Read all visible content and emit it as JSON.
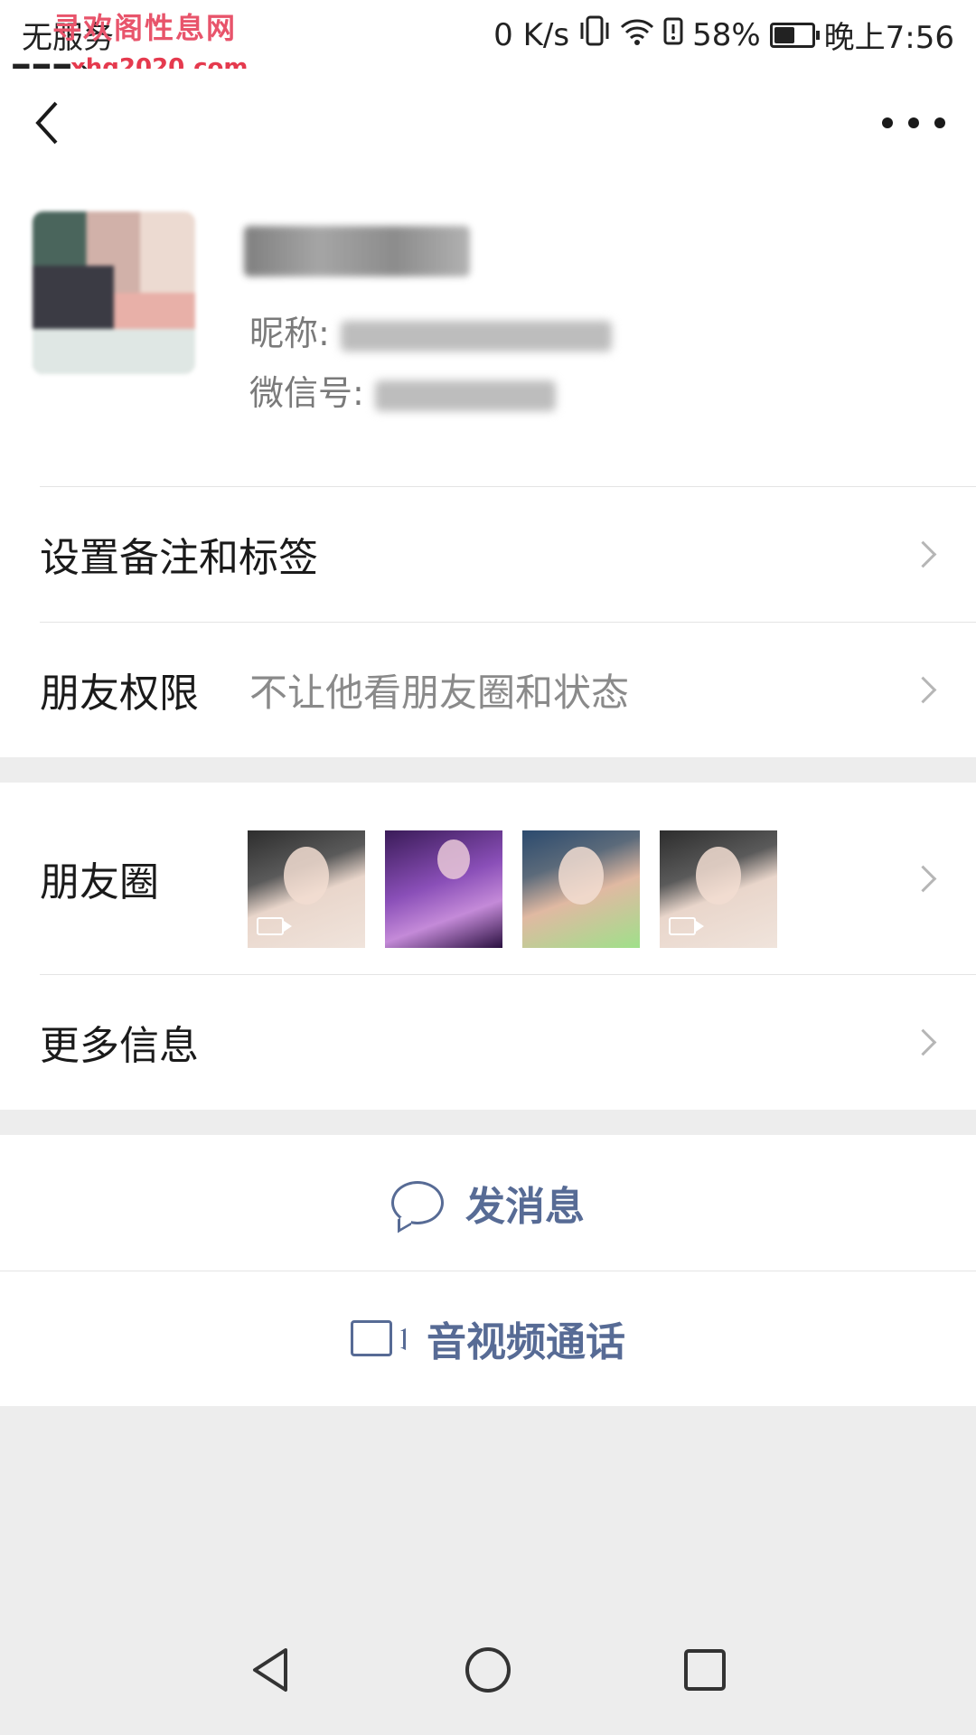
{
  "status_bar": {
    "carrier": "无服务",
    "network_speed": "0 K/s",
    "battery_percent": "58%",
    "time": "晚上7:56",
    "battery_level": 0.58,
    "watermark_title": "寻欢阁性息网",
    "watermark_url": "xhg2020.com"
  },
  "header": {
    "back_icon": "chevron-left-icon",
    "more_icon": "more-dots-icon"
  },
  "profile": {
    "nickname_label": "昵称:",
    "wechat_id_label": "微信号:"
  },
  "rows": {
    "remark_tags": {
      "label": "设置备注和标签"
    },
    "permissions": {
      "label": "朋友权限",
      "value": "不让他看朋友圈和状态"
    },
    "moments": {
      "label": "朋友圈"
    },
    "more_info": {
      "label": "更多信息"
    }
  },
  "actions": {
    "send_message": "发消息",
    "av_call": "音视频通话"
  },
  "colors": {
    "link_blue": "#576b95",
    "background": "#ededed"
  }
}
